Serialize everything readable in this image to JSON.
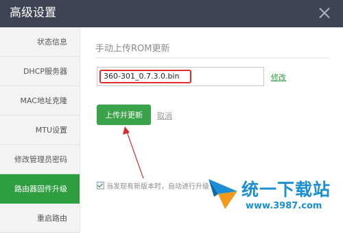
{
  "window": {
    "title": "高级设置"
  },
  "sidebar": {
    "items": [
      {
        "label": "状态信息"
      },
      {
        "label": "DHCP服务器"
      },
      {
        "label": "MAC地址克隆"
      },
      {
        "label": "MTU设置"
      },
      {
        "label": "修改管理员密码"
      },
      {
        "label": "路由器固件升级",
        "active": true
      },
      {
        "label": "重启路由"
      }
    ]
  },
  "main": {
    "section_title": "手动上传ROM更新",
    "file_value": "360-301_0.7.3.0.bin",
    "modify_link": "修改",
    "upload_button": "上传并更新",
    "cancel_link": "取消",
    "auto_upgrade": {
      "checked": true,
      "label": "当发现有新版本时，自动进行升级"
    }
  },
  "watermark": {
    "name": "统一下载站",
    "url": "www.3987.com"
  },
  "icons": {
    "close": "close-icon",
    "arrow": "arrow-annotation",
    "checkbox": "checkbox-checked",
    "logo": "watermark-logo"
  },
  "colors": {
    "titlebar": "#3e4552",
    "accent": "#2f9e41",
    "highlight": "#e02a2a",
    "watermark": "#1a8fd6"
  }
}
